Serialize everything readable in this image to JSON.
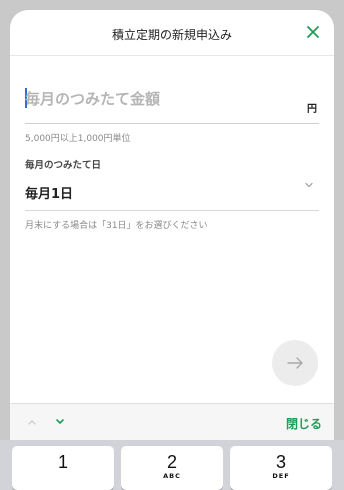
{
  "header": {
    "title": "積立定期の新規申込み"
  },
  "amount": {
    "placeholder": "毎月のつみたて金額",
    "value": "",
    "unit": "円",
    "hint": "5,000円以上1,000円単位"
  },
  "date": {
    "label": "毎月のつみたて日",
    "value": "毎月1日",
    "hint": "月末にする場合は「31日」をお選びください"
  },
  "accessory": {
    "done_label": "閉じる"
  },
  "keypad": {
    "keys": [
      {
        "num": "1",
        "letters": ""
      },
      {
        "num": "2",
        "letters": "ABC"
      },
      {
        "num": "3",
        "letters": "DEF"
      }
    ]
  },
  "colors": {
    "accent": "#1f9d55",
    "caret": "#2a6fd6"
  },
  "icons": {
    "close": "close-icon",
    "next": "arrow-right-icon",
    "chevron": "chevron-down-icon",
    "nav_up": "chevron-up-icon",
    "nav_down": "chevron-down-icon"
  }
}
